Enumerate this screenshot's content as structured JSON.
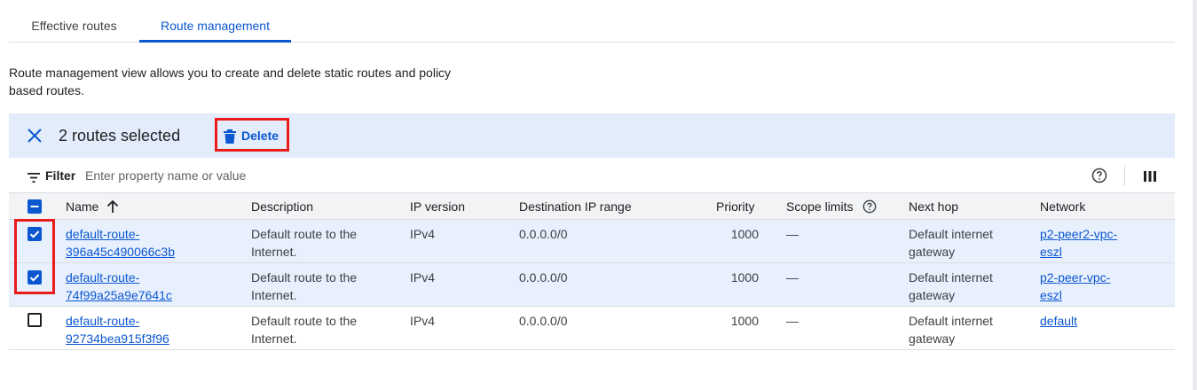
{
  "tabs": [
    {
      "label": "Effective routes",
      "active": false
    },
    {
      "label": "Route management",
      "active": true
    }
  ],
  "intro_text": "Route management view allows you to create and delete static routes and policy\nbased routes.",
  "selection_bar": {
    "count_text": "2 routes selected",
    "delete_label": "Delete"
  },
  "filter": {
    "label": "Filter",
    "placeholder": "Enter property name or value"
  },
  "table": {
    "columns": [
      "Name",
      "Description",
      "IP version",
      "Destination IP range",
      "Priority",
      "Scope limits",
      "Next hop",
      "Network"
    ],
    "rows": [
      {
        "selected": true,
        "name": "default-route-\n396a45c490066c3b",
        "description": "Default route to the\nInternet.",
        "ip_version": "IPv4",
        "dest_range": "0.0.0.0/0",
        "priority": "1000",
        "scope": "—",
        "next_hop": "Default internet\ngateway",
        "network": "p2-peer2-vpc-\neszl"
      },
      {
        "selected": true,
        "name": "default-route-\n74f99a25a9e7641c",
        "description": "Default route to the\nInternet.",
        "ip_version": "IPv4",
        "dest_range": "0.0.0.0/0",
        "priority": "1000",
        "scope": "—",
        "next_hop": "Default internet\ngateway",
        "network": "p2-peer-vpc-\neszl"
      },
      {
        "selected": false,
        "name": "default-route-\n92734bea915f3f96",
        "description": "Default route to the\nInternet.",
        "ip_version": "IPv4",
        "dest_range": "0.0.0.0/0",
        "priority": "1000",
        "scope": "—",
        "next_hop": "Default internet\ngateway",
        "network": "default"
      }
    ]
  },
  "colors": {
    "accent": "#0b57d0",
    "selection_bg": "#e3ecfb",
    "highlight_red": "#ea1c1c"
  }
}
